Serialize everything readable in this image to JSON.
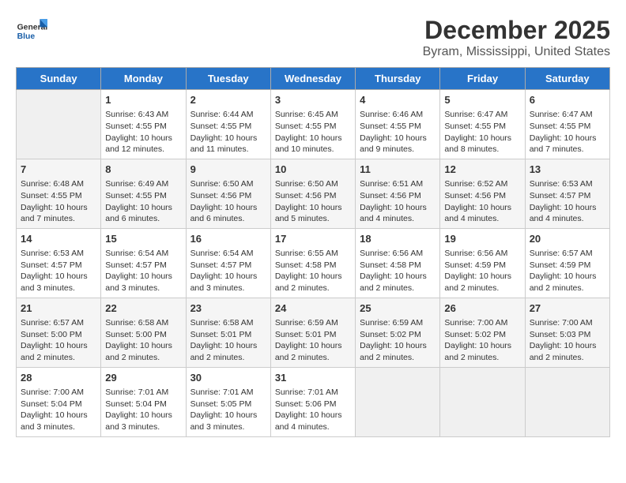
{
  "logo": {
    "general": "General",
    "blue": "Blue"
  },
  "title": "December 2025",
  "subtitle": "Byram, Mississippi, United States",
  "days_header": [
    "Sunday",
    "Monday",
    "Tuesday",
    "Wednesday",
    "Thursday",
    "Friday",
    "Saturday"
  ],
  "weeks": [
    [
      {
        "day": "",
        "info": ""
      },
      {
        "day": "1",
        "info": "Sunrise: 6:43 AM\nSunset: 4:55 PM\nDaylight: 10 hours\nand 12 minutes."
      },
      {
        "day": "2",
        "info": "Sunrise: 6:44 AM\nSunset: 4:55 PM\nDaylight: 10 hours\nand 11 minutes."
      },
      {
        "day": "3",
        "info": "Sunrise: 6:45 AM\nSunset: 4:55 PM\nDaylight: 10 hours\nand 10 minutes."
      },
      {
        "day": "4",
        "info": "Sunrise: 6:46 AM\nSunset: 4:55 PM\nDaylight: 10 hours\nand 9 minutes."
      },
      {
        "day": "5",
        "info": "Sunrise: 6:47 AM\nSunset: 4:55 PM\nDaylight: 10 hours\nand 8 minutes."
      },
      {
        "day": "6",
        "info": "Sunrise: 6:47 AM\nSunset: 4:55 PM\nDaylight: 10 hours\nand 7 minutes."
      }
    ],
    [
      {
        "day": "7",
        "info": "Sunrise: 6:48 AM\nSunset: 4:55 PM\nDaylight: 10 hours\nand 7 minutes."
      },
      {
        "day": "8",
        "info": "Sunrise: 6:49 AM\nSunset: 4:55 PM\nDaylight: 10 hours\nand 6 minutes."
      },
      {
        "day": "9",
        "info": "Sunrise: 6:50 AM\nSunset: 4:56 PM\nDaylight: 10 hours\nand 6 minutes."
      },
      {
        "day": "10",
        "info": "Sunrise: 6:50 AM\nSunset: 4:56 PM\nDaylight: 10 hours\nand 5 minutes."
      },
      {
        "day": "11",
        "info": "Sunrise: 6:51 AM\nSunset: 4:56 PM\nDaylight: 10 hours\nand 4 minutes."
      },
      {
        "day": "12",
        "info": "Sunrise: 6:52 AM\nSunset: 4:56 PM\nDaylight: 10 hours\nand 4 minutes."
      },
      {
        "day": "13",
        "info": "Sunrise: 6:53 AM\nSunset: 4:57 PM\nDaylight: 10 hours\nand 4 minutes."
      }
    ],
    [
      {
        "day": "14",
        "info": "Sunrise: 6:53 AM\nSunset: 4:57 PM\nDaylight: 10 hours\nand 3 minutes."
      },
      {
        "day": "15",
        "info": "Sunrise: 6:54 AM\nSunset: 4:57 PM\nDaylight: 10 hours\nand 3 minutes."
      },
      {
        "day": "16",
        "info": "Sunrise: 6:54 AM\nSunset: 4:57 PM\nDaylight: 10 hours\nand 3 minutes."
      },
      {
        "day": "17",
        "info": "Sunrise: 6:55 AM\nSunset: 4:58 PM\nDaylight: 10 hours\nand 2 minutes."
      },
      {
        "day": "18",
        "info": "Sunrise: 6:56 AM\nSunset: 4:58 PM\nDaylight: 10 hours\nand 2 minutes."
      },
      {
        "day": "19",
        "info": "Sunrise: 6:56 AM\nSunset: 4:59 PM\nDaylight: 10 hours\nand 2 minutes."
      },
      {
        "day": "20",
        "info": "Sunrise: 6:57 AM\nSunset: 4:59 PM\nDaylight: 10 hours\nand 2 minutes."
      }
    ],
    [
      {
        "day": "21",
        "info": "Sunrise: 6:57 AM\nSunset: 5:00 PM\nDaylight: 10 hours\nand 2 minutes."
      },
      {
        "day": "22",
        "info": "Sunrise: 6:58 AM\nSunset: 5:00 PM\nDaylight: 10 hours\nand 2 minutes."
      },
      {
        "day": "23",
        "info": "Sunrise: 6:58 AM\nSunset: 5:01 PM\nDaylight: 10 hours\nand 2 minutes."
      },
      {
        "day": "24",
        "info": "Sunrise: 6:59 AM\nSunset: 5:01 PM\nDaylight: 10 hours\nand 2 minutes."
      },
      {
        "day": "25",
        "info": "Sunrise: 6:59 AM\nSunset: 5:02 PM\nDaylight: 10 hours\nand 2 minutes."
      },
      {
        "day": "26",
        "info": "Sunrise: 7:00 AM\nSunset: 5:02 PM\nDaylight: 10 hours\nand 2 minutes."
      },
      {
        "day": "27",
        "info": "Sunrise: 7:00 AM\nSunset: 5:03 PM\nDaylight: 10 hours\nand 2 minutes."
      }
    ],
    [
      {
        "day": "28",
        "info": "Sunrise: 7:00 AM\nSunset: 5:04 PM\nDaylight: 10 hours\nand 3 minutes."
      },
      {
        "day": "29",
        "info": "Sunrise: 7:01 AM\nSunset: 5:04 PM\nDaylight: 10 hours\nand 3 minutes."
      },
      {
        "day": "30",
        "info": "Sunrise: 7:01 AM\nSunset: 5:05 PM\nDaylight: 10 hours\nand 3 minutes."
      },
      {
        "day": "31",
        "info": "Sunrise: 7:01 AM\nSunset: 5:06 PM\nDaylight: 10 hours\nand 4 minutes."
      },
      {
        "day": "",
        "info": ""
      },
      {
        "day": "",
        "info": ""
      },
      {
        "day": "",
        "info": ""
      }
    ]
  ]
}
